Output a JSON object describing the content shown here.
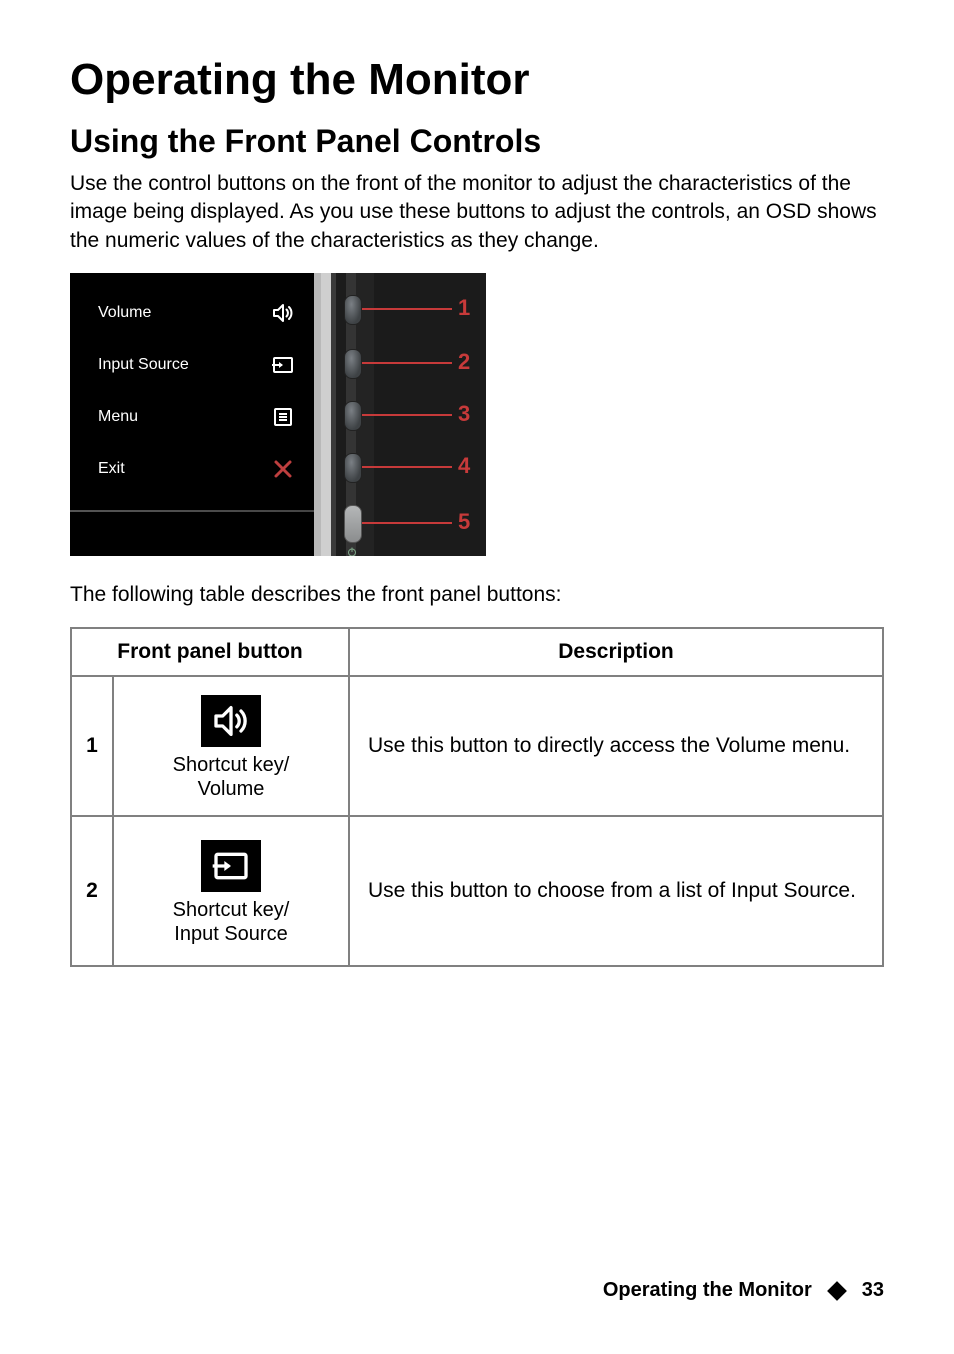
{
  "title": "Operating the Monitor",
  "subtitle": "Using the Front Panel Controls",
  "intro": "Use the control buttons on the front of the monitor to adjust the characteristics of the image being displayed. As you use these buttons to adjust the controls, an OSD shows the numeric values of the characteristics as they change.",
  "diagram": {
    "rows": [
      {
        "label": "Volume",
        "icon": "volume"
      },
      {
        "label": "Input Source",
        "icon": "input"
      },
      {
        "label": "Menu",
        "icon": "menu"
      },
      {
        "label": "Exit",
        "icon": "exit"
      }
    ],
    "callouts": [
      "1",
      "2",
      "3",
      "4",
      "5"
    ]
  },
  "table_intro": "The following table describes the front panel buttons:",
  "table": {
    "header_button": "Front panel button",
    "header_desc": "Description",
    "rows": [
      {
        "num": "1",
        "icon": "volume",
        "caption_l1": "Shortcut key/",
        "caption_l2": "Volume",
        "desc": "Use this button to directly access the Volume menu."
      },
      {
        "num": "2",
        "icon": "input",
        "caption_l1": "Shortcut key/",
        "caption_l2": "Input Source",
        "desc": "Use this button to choose from a list of Input Source."
      }
    ]
  },
  "footer": {
    "section": "Operating the Monitor",
    "page": "33"
  }
}
